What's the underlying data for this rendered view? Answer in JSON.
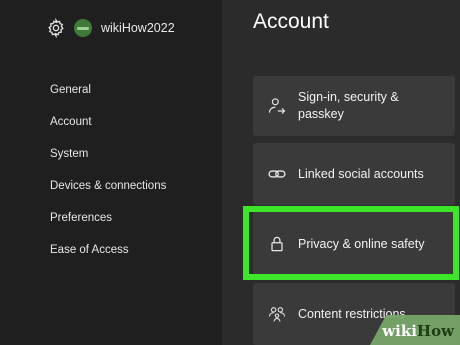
{
  "header": {
    "username": "wikiHow2022"
  },
  "sidebar": {
    "items": [
      {
        "label": "General"
      },
      {
        "label": "Account"
      },
      {
        "label": "System"
      },
      {
        "label": "Devices & connections"
      },
      {
        "label": "Preferences"
      },
      {
        "label": "Ease of Access"
      }
    ]
  },
  "main": {
    "title": "Account",
    "cards": [
      {
        "label_line1": "Sign-in, security &",
        "label_line2": "passkey",
        "icon": "person-arrow-icon"
      },
      {
        "label": "Linked social accounts",
        "icon": "link-icon"
      },
      {
        "label": "Privacy & online safety",
        "icon": "lock-icon",
        "highlighted": true
      },
      {
        "label": "Content restrictions",
        "icon": "family-icon"
      }
    ]
  },
  "watermark": {
    "part1": "wiki",
    "part2": "How"
  },
  "colors": {
    "highlight": "#3ee62a",
    "card": "#3a3a3a",
    "background": "#2b2b2b",
    "sidebar": "#1f1f1f"
  }
}
